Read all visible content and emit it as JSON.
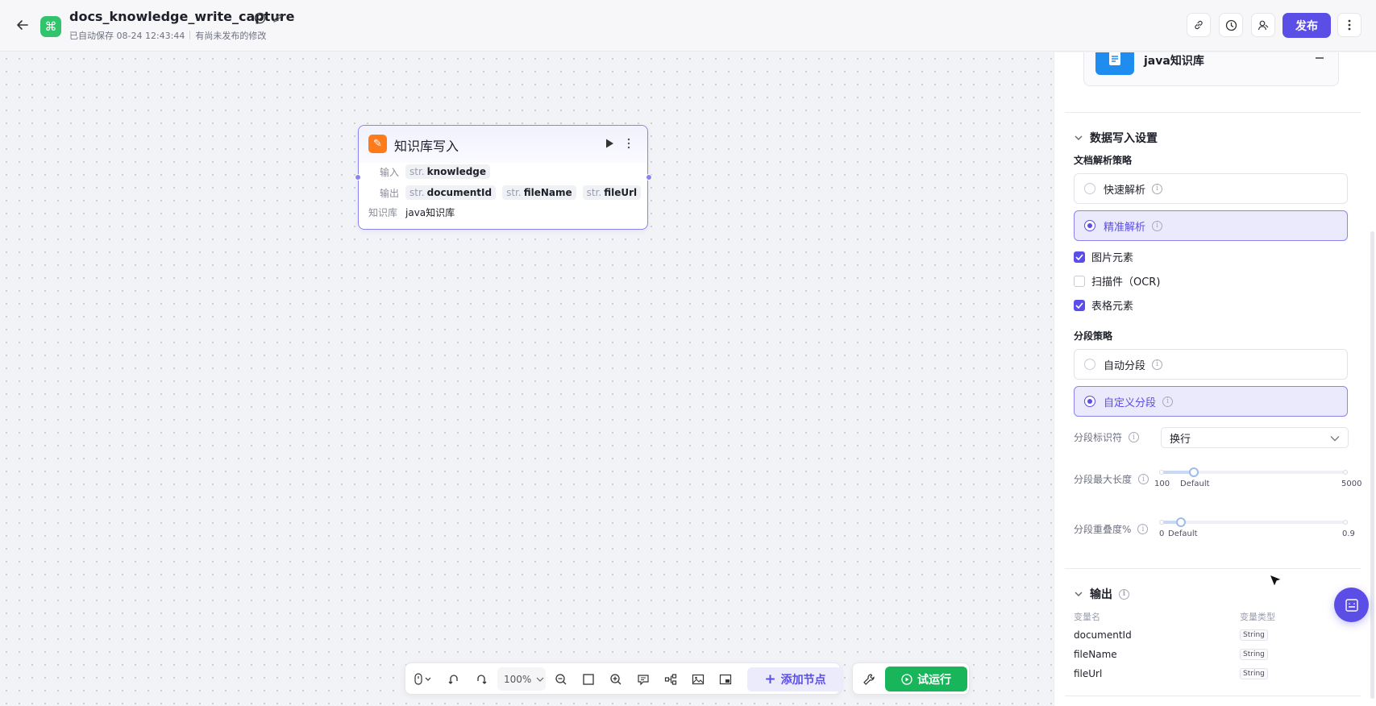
{
  "header": {
    "title": "docs_knowledge_write_capture",
    "autosave": "已自动保存 08-24 12:43:44",
    "unpublished": "有尚未发布的修改",
    "publish_label": "发布"
  },
  "node": {
    "title": "知识库写入",
    "input_label": "输入",
    "input_vars": [
      {
        "type": "str.",
        "name": "knowledge"
      }
    ],
    "output_label": "输出",
    "output_vars": [
      {
        "type": "str.",
        "name": "documentId"
      },
      {
        "type": "str.",
        "name": "fileName"
      },
      {
        "type": "str.",
        "name": "fileUrl"
      }
    ],
    "kb_label": "知识库",
    "kb_value": "java知识库"
  },
  "toolbar": {
    "zoom": "100%",
    "add_node": "添加节点",
    "trial_run": "试运行"
  },
  "panel": {
    "kb_name": "java知识库",
    "write_settings_title": "数据写入设置",
    "parse_strategy_title": "文档解析策略",
    "parse_options": [
      {
        "label": "快速解析",
        "selected": false
      },
      {
        "label": "精准解析",
        "selected": true
      }
    ],
    "parse_checks": [
      {
        "label": "图片元素",
        "checked": true
      },
      {
        "label": "扫描件（OCR)",
        "checked": false
      },
      {
        "label": "表格元素",
        "checked": true
      }
    ],
    "segment_strategy_title": "分段策略",
    "segment_options": [
      {
        "label": "自动分段",
        "selected": false
      },
      {
        "label": "自定义分段",
        "selected": true
      }
    ],
    "separator_label": "分段标识符",
    "separator_value": "换行",
    "max_length_label": "分段最大长度",
    "max_length": {
      "min": "100",
      "max": "5000",
      "default_label": "Default",
      "fraction": 0.18
    },
    "overlap_label": "分段重叠度%",
    "overlap": {
      "min": "0",
      "max": "0.9",
      "default_label": "Default",
      "fraction": 0.11
    },
    "output_title": "输出",
    "output_col_name": "变量名",
    "output_col_type": "变量类型",
    "outputs": [
      {
        "name": "documentId",
        "type": "String"
      },
      {
        "name": "fileName",
        "type": "String"
      },
      {
        "name": "fileUrl",
        "type": "String"
      }
    ]
  },
  "colors": {
    "accent": "#5b4ee6",
    "success": "#19b55a",
    "kb_icon": "#1f8cf0",
    "node_icon": "#ff7a1a"
  }
}
